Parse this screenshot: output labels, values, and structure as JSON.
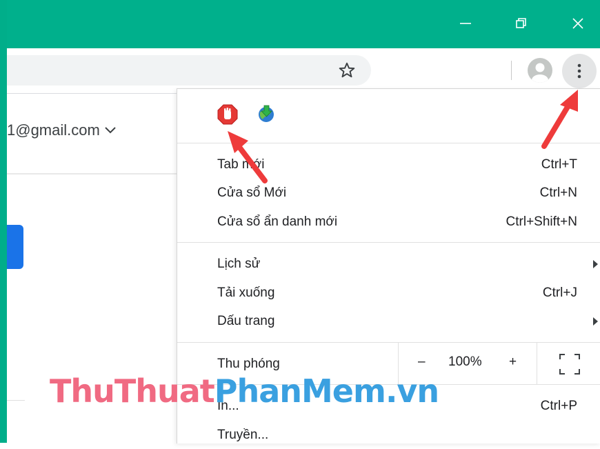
{
  "window": {
    "accent_color": "#00b08c",
    "controls": [
      "minimize-icon",
      "restore-icon",
      "close-icon"
    ]
  },
  "page": {
    "account_email": "1@gmail.com",
    "button_color": "#1a73e8"
  },
  "menu": {
    "extensions": [
      "adblock-icon",
      "idm-icon"
    ],
    "group1": [
      {
        "label": "Tab mới",
        "shortcut": "Ctrl+T"
      },
      {
        "label": "Cửa sổ Mới",
        "shortcut": "Ctrl+N"
      },
      {
        "label": "Cửa sổ ẩn danh mới",
        "shortcut": "Ctrl+Shift+N"
      }
    ],
    "group2": [
      {
        "label": "Lịch sử",
        "shortcut": ""
      },
      {
        "label": "Tải xuống",
        "shortcut": "Ctrl+J"
      },
      {
        "label": "Dấu trang",
        "shortcut": ""
      }
    ],
    "zoom": {
      "label": "Thu phóng",
      "minus": "–",
      "value": "100%",
      "plus": "+"
    },
    "group3": [
      {
        "label": "In...",
        "shortcut": "Ctrl+P"
      },
      {
        "label": "Truyền...",
        "shortcut": ""
      }
    ]
  },
  "watermark": {
    "part1": "ThuThuat",
    "part2": "PhanMem.vn"
  },
  "annotation_color": "#ee3b3b"
}
